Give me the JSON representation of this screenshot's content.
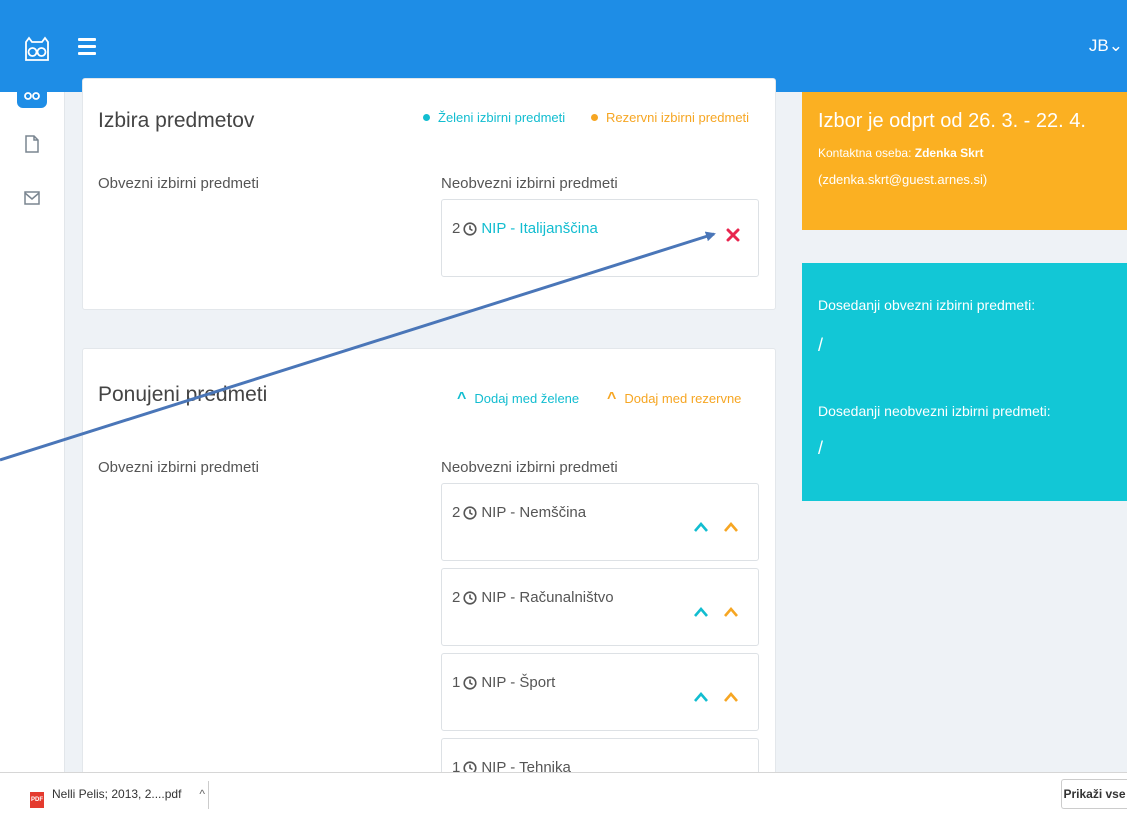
{
  "header": {
    "user_initials": "JB",
    "user_chevron": "⌄",
    "logo_icon": "owl-logo-icon",
    "menu_icon": "hamburger-icon"
  },
  "leftnav": {
    "items": [
      {
        "icon": "owl-icon",
        "active": true
      },
      {
        "icon": "document-icon"
      },
      {
        "icon": "envelope-icon"
      }
    ]
  },
  "selection": {
    "title": "Izbira predmetov",
    "legend_wanted": "Želeni izbirni predmeti",
    "legend_reserve": "Rezervni izbirni predmeti",
    "col_mandatory": "Obvezni izbirni predmeti",
    "col_optional": "Neobvezni izbirni predmeti",
    "selected": [
      {
        "hours": "2",
        "name": "NIP - Italijanščina"
      }
    ]
  },
  "offered": {
    "title": "Ponujeni predmeti",
    "add_wanted": "Dodaj med želene",
    "add_reserve": "Dodaj med rezervne",
    "col_mandatory": "Obvezni izbirni predmeti",
    "col_optional": "Neobvezni izbirni predmeti",
    "subjects": [
      {
        "hours": "2",
        "name": "NIP - Nemščina"
      },
      {
        "hours": "2",
        "name": "NIP - Računalništvo"
      },
      {
        "hours": "1",
        "name": "NIP - Šport"
      },
      {
        "hours": "1",
        "name": "NIP - Tehnika"
      }
    ]
  },
  "info": {
    "open_period": "Izbor je odprt od 26. 3. - 22. 4.",
    "contact_label": "Kontaktna oseba:",
    "contact_name": "Zdenka Skrt",
    "contact_email": "(zdenka.skrt@guest.arnes.si)"
  },
  "previous": {
    "mandatory_label": "Dosedanji obvezni izbirni predmeti:",
    "mandatory_value": "/",
    "optional_label": "Dosedanji neobvezni izbirni predmeti:",
    "optional_value": "/"
  },
  "downloads": {
    "file_name": "Nelli Pelis; 2013, 2....pdf",
    "file_icon_text": "PDF",
    "show_all": "Prikaži vse"
  },
  "colors": {
    "primary": "#1e8de6",
    "wanted": "#12bdd0",
    "reserve": "#f6a623",
    "remove": "#e8264f"
  }
}
